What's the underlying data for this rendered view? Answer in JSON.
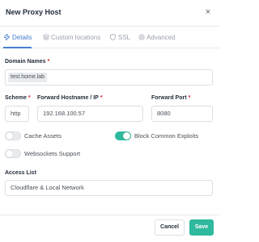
{
  "modal": {
    "title": "New Proxy Host",
    "close_icon": "×"
  },
  "tabs": [
    {
      "label": "Details",
      "icon": "bolt-icon",
      "active": true
    },
    {
      "label": "Custom locations",
      "icon": "layers-icon",
      "active": false
    },
    {
      "label": "SSL",
      "icon": "shield-icon",
      "active": false
    },
    {
      "label": "Advanced",
      "icon": "gear-icon",
      "active": false
    }
  ],
  "form": {
    "domain_names": {
      "label": "Domain Names",
      "required": "*",
      "tags": [
        "test.home.lab"
      ]
    },
    "scheme": {
      "label": "Scheme",
      "required": "*",
      "value": "http"
    },
    "forward_host": {
      "label": "Forward Hostname / IP",
      "required": "*",
      "value": "192.168.100.57"
    },
    "forward_port": {
      "label": "Forward Port",
      "required": "*",
      "value": "8080"
    },
    "toggles": {
      "cache_assets": {
        "label": "Cache Assets",
        "on": false
      },
      "block_exploits": {
        "label": "Block Common Exploits",
        "on": true
      },
      "websockets": {
        "label": "Websockets Support",
        "on": false
      }
    },
    "access_list": {
      "label": "Access List",
      "value": "Cloudflare & Local Network"
    }
  },
  "footer": {
    "cancel_label": "Cancel",
    "save_label": "Save"
  },
  "colors": {
    "accent": "#467fcf",
    "success": "#2fb99e",
    "required": "#cd201f"
  }
}
